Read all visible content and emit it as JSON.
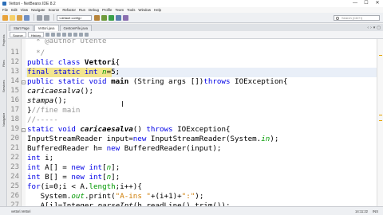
{
  "window": {
    "title": "Vettori - NetBeans IDE 8.2",
    "controls": [
      "—",
      "☐",
      "✕"
    ]
  },
  "menubar": {
    "items": [
      "File",
      "Edit",
      "View",
      "Navigate",
      "Source",
      "Refactor",
      "Run",
      "Debug",
      "Profile",
      "Team",
      "Tools",
      "Window",
      "Help"
    ]
  },
  "toolbar": {
    "config_combo": "<default config>",
    "search_placeholder": "Search (Ctrl+I)"
  },
  "left_panels": [
    "Projects",
    "Files",
    "Services",
    "Navigator"
  ],
  "editor_tabs": [
    {
      "label": "Start Page",
      "active": false
    },
    {
      "label": "Vettori.java",
      "active": true
    },
    {
      "label": "GestoreFile.java",
      "active": false
    }
  ],
  "editor_toolbar": {
    "source_label": "Source",
    "history_label": "History"
  },
  "code": {
    "line_numbers": [
      "",
      "11",
      "12",
      "13",
      "14",
      "15",
      "16",
      "17",
      "18",
      "19",
      "20",
      "21",
      "22",
      "23",
      "24",
      "25",
      "26",
      "27"
    ],
    "lines": [
      {
        "parts": [
          {
            "t": "  * @author Utente",
            "c": "cm"
          }
        ]
      },
      {
        "parts": [
          {
            "t": "  */",
            "c": "cm"
          }
        ]
      },
      {
        "parts": [
          {
            "t": "public class ",
            "c": "kw"
          },
          {
            "t": "Vettori",
            "c": "bd"
          },
          {
            "t": "{",
            "c": ""
          }
        ]
      },
      {
        "parts": [
          {
            "t": "final static int ",
            "c": "kw"
          },
          {
            "t": "n",
            "c": "fld it"
          },
          {
            "t": "=5;",
            "c": ""
          }
        ]
      },
      {
        "parts": [
          {
            "t": "public static void ",
            "c": "kw"
          },
          {
            "t": "main",
            "c": "bd"
          },
          {
            "t": " (String args [])",
            "c": ""
          },
          {
            "t": "throws ",
            "c": "kw"
          },
          {
            "t": "IOException{",
            "c": ""
          }
        ]
      },
      {
        "parts": [
          {
            "t": "caricaesalva",
            "c": "it"
          },
          {
            "t": "();",
            "c": ""
          }
        ]
      },
      {
        "parts": [
          {
            "t": "stampa",
            "c": "it"
          },
          {
            "t": "();",
            "c": ""
          }
        ]
      },
      {
        "parts": [
          {
            "t": "}",
            "c": ""
          },
          {
            "t": "//fine main",
            "c": "cm"
          }
        ]
      },
      {
        "parts": [
          {
            "t": "//-----",
            "c": "cm"
          }
        ]
      },
      {
        "parts": [
          {
            "t": "static void ",
            "c": "kw"
          },
          {
            "t": "caricaesalva",
            "c": "bd it"
          },
          {
            "t": "() ",
            "c": ""
          },
          {
            "t": "throws ",
            "c": "kw"
          },
          {
            "t": "IOException{",
            "c": ""
          }
        ]
      },
      {
        "parts": [
          {
            "t": "InputStreamReader input=",
            "c": ""
          },
          {
            "t": "new ",
            "c": "kw"
          },
          {
            "t": "InputStreamReader(System.",
            "c": ""
          },
          {
            "t": "in",
            "c": "fld it"
          },
          {
            "t": ");",
            "c": ""
          }
        ]
      },
      {
        "parts": [
          {
            "t": "BufferedReader h= ",
            "c": ""
          },
          {
            "t": "new ",
            "c": "kw"
          },
          {
            "t": "BufferedReader(input);",
            "c": ""
          }
        ]
      },
      {
        "parts": [
          {
            "t": "int ",
            "c": "kw"
          },
          {
            "t": "i;",
            "c": ""
          }
        ]
      },
      {
        "parts": [
          {
            "t": "int ",
            "c": "kw"
          },
          {
            "t": "A[] = ",
            "c": ""
          },
          {
            "t": "new int",
            "c": "kw"
          },
          {
            "t": "[",
            "c": ""
          },
          {
            "t": "n",
            "c": "fld it"
          },
          {
            "t": "];",
            "c": ""
          }
        ]
      },
      {
        "parts": [
          {
            "t": "int ",
            "c": "kw"
          },
          {
            "t": "B[] = ",
            "c": ""
          },
          {
            "t": "new int",
            "c": "kw"
          },
          {
            "t": "[",
            "c": ""
          },
          {
            "t": "n",
            "c": "fld it"
          },
          {
            "t": "];",
            "c": ""
          }
        ]
      },
      {
        "parts": [
          {
            "t": "for",
            "c": "kw"
          },
          {
            "t": "(i=0;i < A.",
            "c": ""
          },
          {
            "t": "length",
            "c": "fld"
          },
          {
            "t": ";i++){",
            "c": ""
          }
        ]
      },
      {
        "parts": [
          {
            "t": "   System.",
            "c": ""
          },
          {
            "t": "out",
            "c": "fld it"
          },
          {
            "t": ".print(",
            "c": ""
          },
          {
            "t": "\"A-ins \"",
            "c": "str"
          },
          {
            "t": "+(i+1)+",
            "c": ""
          },
          {
            "t": "\":\"",
            "c": "str"
          },
          {
            "t": ");",
            "c": ""
          }
        ]
      },
      {
        "parts": [
          {
            "t": "   A[i]=Integer.",
            "c": ""
          },
          {
            "t": "parseInt",
            "c": "it"
          },
          {
            "t": "(h.readLine().trim());",
            "c": ""
          }
        ]
      }
    ]
  },
  "status": {
    "file": "vettori.Vettori",
    "ins_mode": "INS",
    "caret": "14:11:22"
  }
}
